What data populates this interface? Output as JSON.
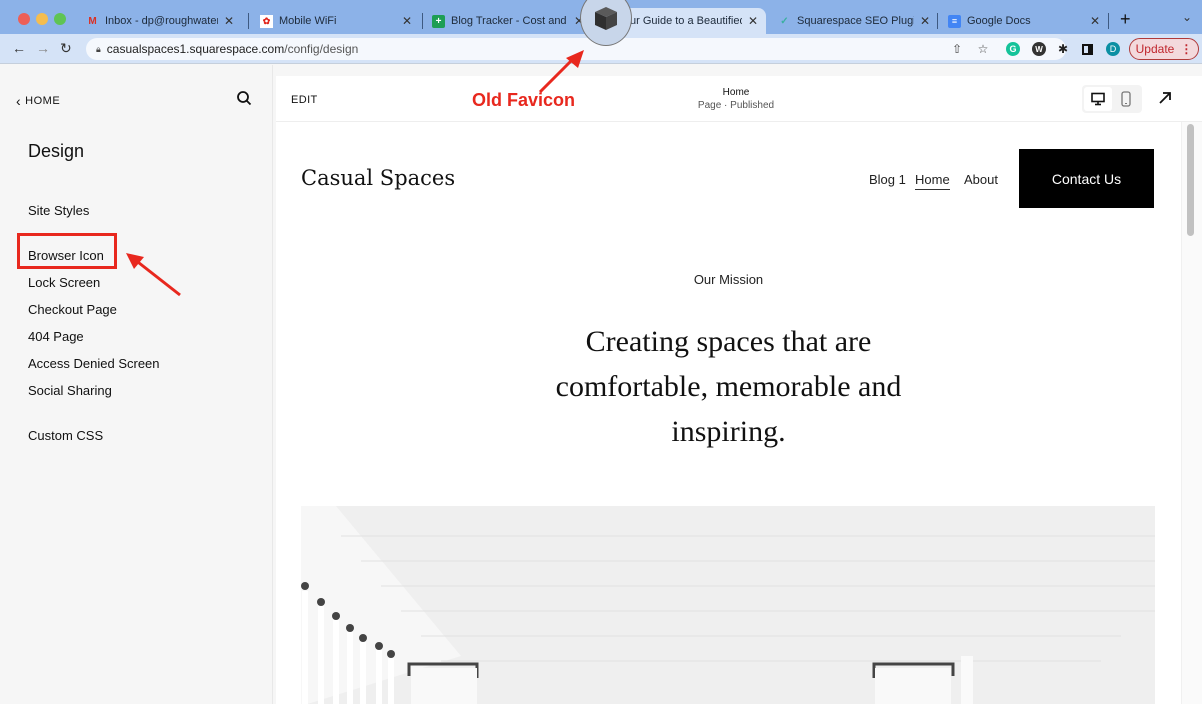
{
  "browser": {
    "tabs": [
      {
        "title": "Inbox - dp@roughwaterme",
        "favicon": "gmail-icon"
      },
      {
        "title": "Mobile WiFi",
        "favicon": "huawei-icon"
      },
      {
        "title": "Blog Tracker - Cost and Tim",
        "favicon": "google-sheets-icon"
      },
      {
        "title": "ur Guide to a Beautified",
        "favicon": "cube-favicon-icon",
        "active": true
      },
      {
        "title": "Squarespace SEO Plugin |",
        "favicon": "checkmark-icon"
      },
      {
        "title": "Google Docs",
        "favicon": "google-docs-icon"
      }
    ],
    "new_tab": "+",
    "tab_menu": "⌄",
    "url_host": "casualspaces1.squarespace.com",
    "url_path": "/config/design",
    "profile_initial": "D",
    "update_label": "Update",
    "extension_g": "G",
    "extension_w": "W"
  },
  "annotations": {
    "favicon_label": "Old Favicon",
    "colors": {
      "annotation_red": "#e8281e"
    }
  },
  "sidebar": {
    "back_label": "HOME",
    "title": "Design",
    "items": [
      {
        "label": "Site Styles"
      },
      {
        "label": "Browser Icon",
        "highlighted": true
      },
      {
        "label": "Lock Screen"
      },
      {
        "label": "Checkout Page"
      },
      {
        "label": "404 Page"
      },
      {
        "label": "Access Denied Screen"
      },
      {
        "label": "Social Sharing"
      },
      {
        "label": "Custom CSS"
      }
    ]
  },
  "preview_header": {
    "edit_label": "EDIT",
    "page_name": "Home",
    "page_status": "Page · Published"
  },
  "site": {
    "logo": "Casual Spaces",
    "nav": [
      {
        "label": "Blog 1"
      },
      {
        "label": "Home",
        "current": true
      },
      {
        "label": "About"
      }
    ],
    "cta_label": "Contact Us",
    "eyebrow": "Our Mission",
    "headline_lines": [
      "Creating spaces that are",
      "comfortable, memorable and",
      "inspiring."
    ]
  }
}
